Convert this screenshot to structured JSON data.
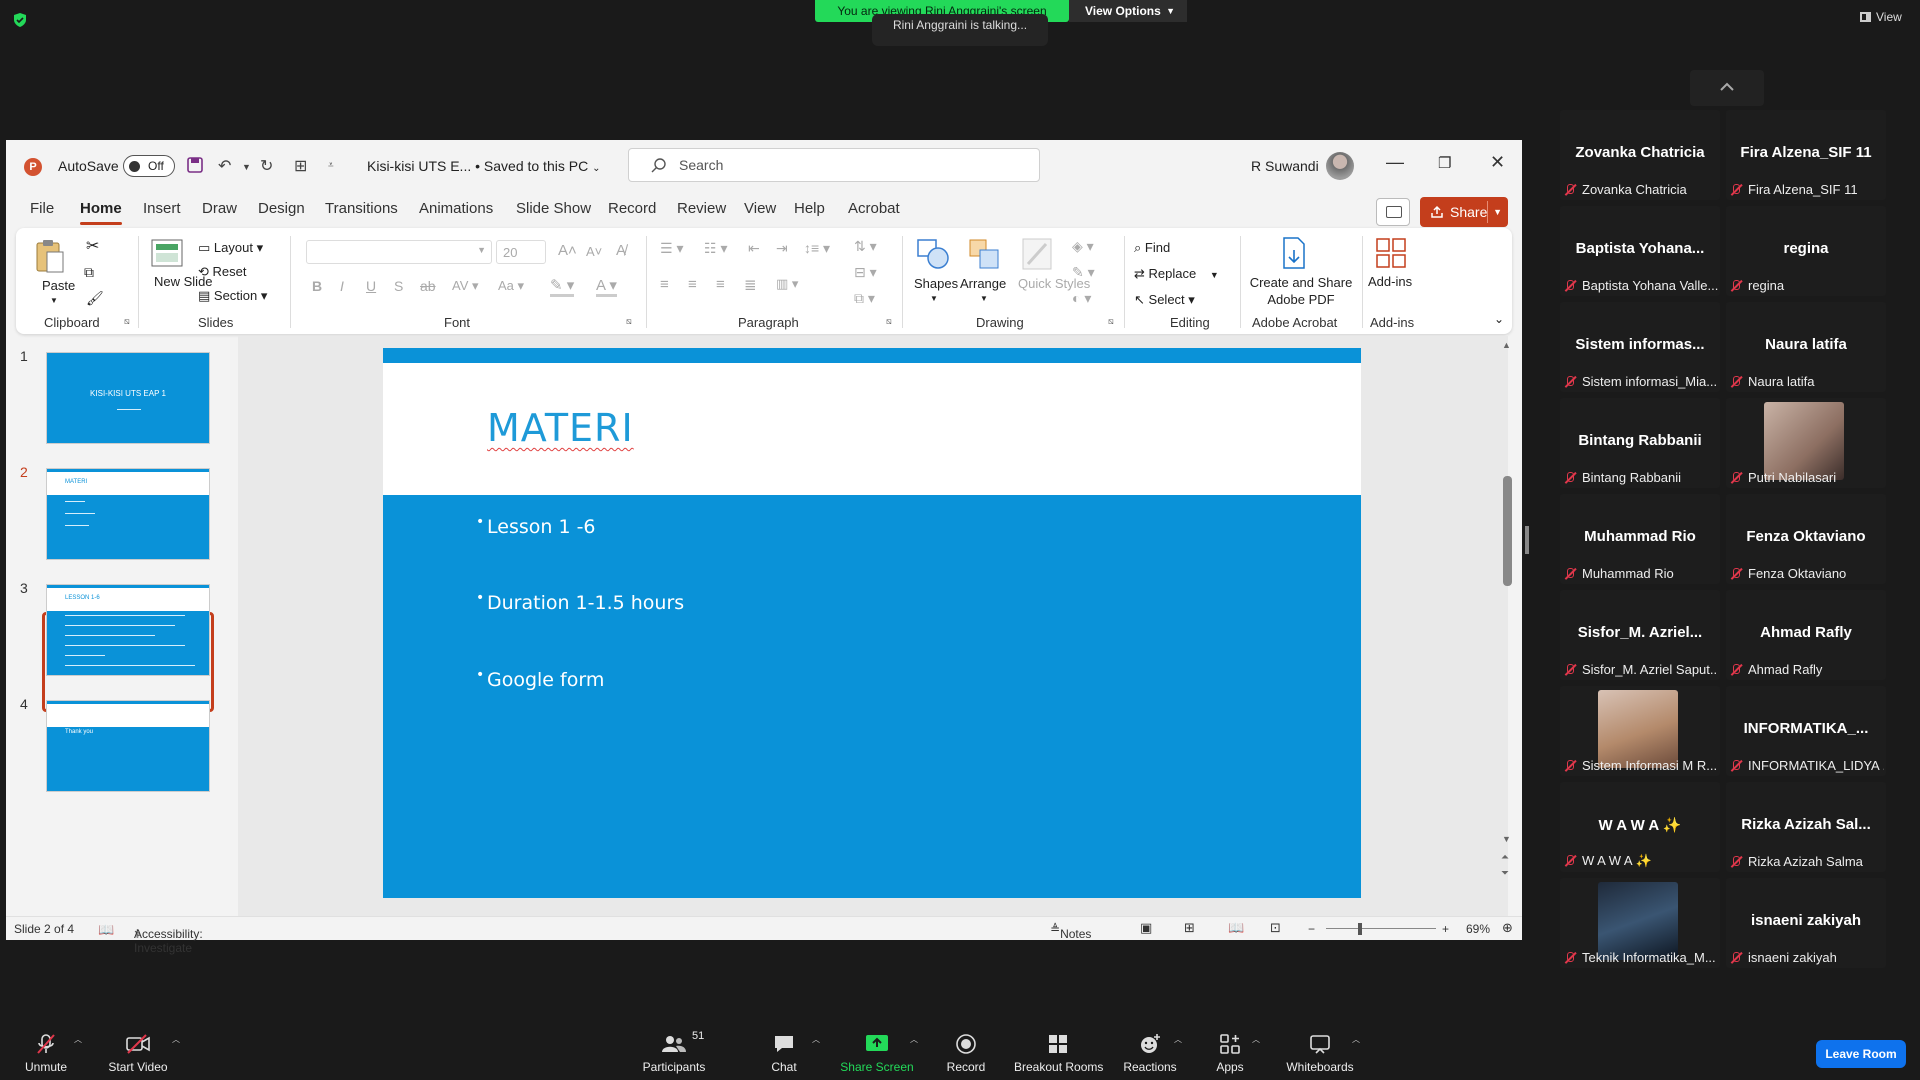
{
  "zoom": {
    "banner": "You are viewing Rini Anggraini's screen",
    "view_options": "View Options",
    "talking": "Rini Anggraini is talking...",
    "view_button": "View",
    "leave_button": "Leave Room",
    "toolbar": [
      {
        "label": "Unmute",
        "icon": "muted-mic-icon"
      },
      {
        "label": "Start Video",
        "icon": "video-off-icon"
      },
      {
        "label": "Participants",
        "icon": "participants-icon",
        "count": "51"
      },
      {
        "label": "Chat",
        "icon": "chat-icon"
      },
      {
        "label": "Share Screen",
        "icon": "share-screen-icon"
      },
      {
        "label": "Record",
        "icon": "record-icon"
      },
      {
        "label": "Breakout Rooms",
        "icon": "breakout-rooms-icon"
      },
      {
        "label": "Reactions",
        "icon": "reactions-icon"
      },
      {
        "label": "Apps",
        "icon": "apps-icon"
      },
      {
        "label": "Whiteboards",
        "icon": "whiteboard-icon"
      }
    ],
    "participants": [
      {
        "name": "Zovanka Chatricia",
        "label": "Zovanka Chatricia"
      },
      {
        "name": "Fira Alzena_SIF 11",
        "label": "Fira Alzena_SIF 11"
      },
      {
        "name": "Baptista Yohana...",
        "label": "Baptista Yohana Valle..."
      },
      {
        "name": "regina",
        "label": "regina"
      },
      {
        "name": "Sistem informas...",
        "label": "Sistem informasi_Mia..."
      },
      {
        "name": "Naura latifa",
        "label": "Naura latifa"
      },
      {
        "name": "Bintang Rabbanii",
        "label": "Bintang Rabbanii"
      },
      {
        "name": "",
        "label": "Putri Nabilasari"
      },
      {
        "name": "Muhammad Rio",
        "label": "Muhammad Rio"
      },
      {
        "name": "Fenza Oktaviano",
        "label": "Fenza Oktaviano"
      },
      {
        "name": "Sisfor_M. Azriel...",
        "label": "Sisfor_M. Azriel Saput..."
      },
      {
        "name": "Ahmad Rafly",
        "label": "Ahmad Rafly"
      },
      {
        "name": "",
        "label": "Sistem Informasi M R..."
      },
      {
        "name": "INFORMATIKA_...",
        "label": "INFORMATIKA_LIDYA ..."
      },
      {
        "name": "W A W A ✨",
        "label": "W A W A ✨"
      },
      {
        "name": "Rizka Azizah Sal...",
        "label": "Rizka Azizah Salma"
      },
      {
        "name": "",
        "label": "Teknik Informatika_M..."
      },
      {
        "name": "isnaeni zakiyah",
        "label": "isnaeni zakiyah"
      }
    ]
  },
  "ppt": {
    "autosave_label": "AutoSave",
    "autosave_state": "Off",
    "doc_title": "Kisi-kisi UTS E...  •  Saved to this PC",
    "search_placeholder": "Search",
    "user_name": "R Suwandi",
    "share_label": "Share",
    "tabs": [
      "File",
      "Home",
      "Insert",
      "Draw",
      "Design",
      "Transitions",
      "Animations",
      "Slide Show",
      "Record",
      "Review",
      "View",
      "Help",
      "Acrobat"
    ],
    "ribbon": {
      "paste": "Paste",
      "new_slide": "New Slide",
      "layout": "Layout",
      "reset": "Reset",
      "section": "Section",
      "font_size": "20",
      "shapes": "Shapes",
      "arrange": "Arrange",
      "quick_styles": "Quick Styles",
      "find": "Find",
      "replace": "Replace",
      "select": "Select",
      "create_pdf": "Create and Share Adobe PDF",
      "addins": "Add-ins",
      "groups": {
        "clipboard": "Clipboard",
        "slides": "Slides",
        "font": "Font",
        "paragraph": "Paragraph",
        "drawing": "Drawing",
        "editing": "Editing",
        "acrobat": "Adobe Acrobat",
        "addins": "Add-ins"
      }
    },
    "thumbnails": [
      {
        "num": "1",
        "text": "KISI-KISI UTS EAP 1"
      },
      {
        "num": "2",
        "text": "MATERI"
      },
      {
        "num": "3",
        "text": "LESSON 1-6"
      },
      {
        "num": "4",
        "text": "Thank you"
      }
    ],
    "slide": {
      "title": "MATERI",
      "bullets": [
        "Lesson 1 -6",
        "Duration 1-1.5 hours",
        "Google form"
      ]
    },
    "status": {
      "slide_info": "Slide 2 of 4",
      "accessibility": "Accessibility: Investigate",
      "notes": "Notes",
      "zoom": "69%"
    }
  }
}
